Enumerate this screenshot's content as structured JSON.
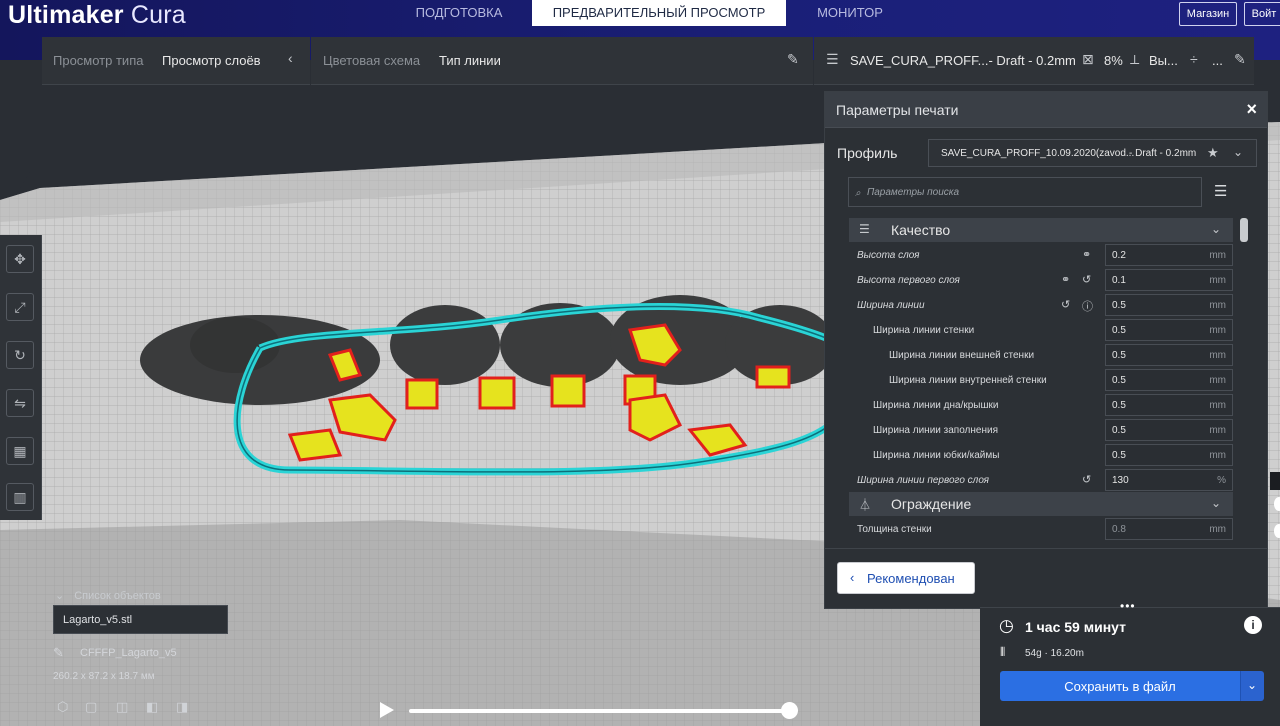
{
  "app": {
    "logo_bold": "Ultimaker",
    "logo_light": "Cura"
  },
  "stages": [
    {
      "label": "ПОДГОТОВКА",
      "active": false
    },
    {
      "label": "ПРЕДВАРИТЕЛЬНЫЙ ПРОСМОТР",
      "active": true
    },
    {
      "label": "МОНИТОР",
      "active": false
    }
  ],
  "header_buttons": {
    "marketplace": "Магазин",
    "signin": "Войт"
  },
  "toolbar": {
    "view_type_label": "Просмотр типа",
    "view_type_value": "Просмотр слоёв",
    "color_scheme_label": "Цветовая схема",
    "color_scheme_value": "Тип линии",
    "profile_summary": "SAVE_CURA_PROFF...- Draft - 0.2mm",
    "infill_percent": "8%",
    "support_label": "Вы...",
    "adhesion_label": "..."
  },
  "panel": {
    "title": "Параметры печати",
    "profile_label": "Профиль",
    "profile_value": "SAVE_CURA_PROFF_10.09.2020(zavod...",
    "profile_quality": "- Draft - 0.2mm",
    "search_placeholder": "Параметры поиска",
    "categories": [
      {
        "title": "Качество"
      },
      {
        "title": "Ограждение"
      }
    ],
    "settings": [
      {
        "label": "Высота слоя",
        "value": "0.2",
        "unit": "mm"
      },
      {
        "label": "Высота первого слоя",
        "value": "0.1",
        "unit": "mm"
      },
      {
        "label": "Ширина линии",
        "value": "0.5",
        "unit": "mm"
      },
      {
        "label": "Ширина линии стенки",
        "value": "0.5",
        "unit": "mm"
      },
      {
        "label": "Ширина линии внешней стенки",
        "value": "0.5",
        "unit": "mm"
      },
      {
        "label": "Ширина линии внутренней стенки",
        "value": "0.5",
        "unit": "mm"
      },
      {
        "label": "Ширина линии дна/крышки",
        "value": "0.5",
        "unit": "mm"
      },
      {
        "label": "Ширина линии заполнения",
        "value": "0.5",
        "unit": "mm"
      },
      {
        "label": "Ширина линии юбки/каймы",
        "value": "0.5",
        "unit": "mm"
      },
      {
        "label": "Ширина линии первого слоя",
        "value": "130",
        "unit": "%"
      },
      {
        "label": "Толщина стенки",
        "value": "0.8",
        "unit": "mm"
      }
    ],
    "recommended_button": "Рекомендован"
  },
  "objects": {
    "header": "Список объектов",
    "file": "Lagarto_v5.stl",
    "job_name": "CFFFP_Lagarto_v5",
    "dimensions": "260.2 x 87.2 x 18.7 мм"
  },
  "estimate": {
    "time": "1 час 59 минут",
    "material": "54g · 16.20m",
    "save_button": "Сохранить в файл"
  },
  "colors": {
    "header_bg": "#1a1f78",
    "accent": "#2b6fe3",
    "wall_inner": "#2ad4d6",
    "infill": "#e6e31e",
    "outer_wall": "#e2201c"
  }
}
